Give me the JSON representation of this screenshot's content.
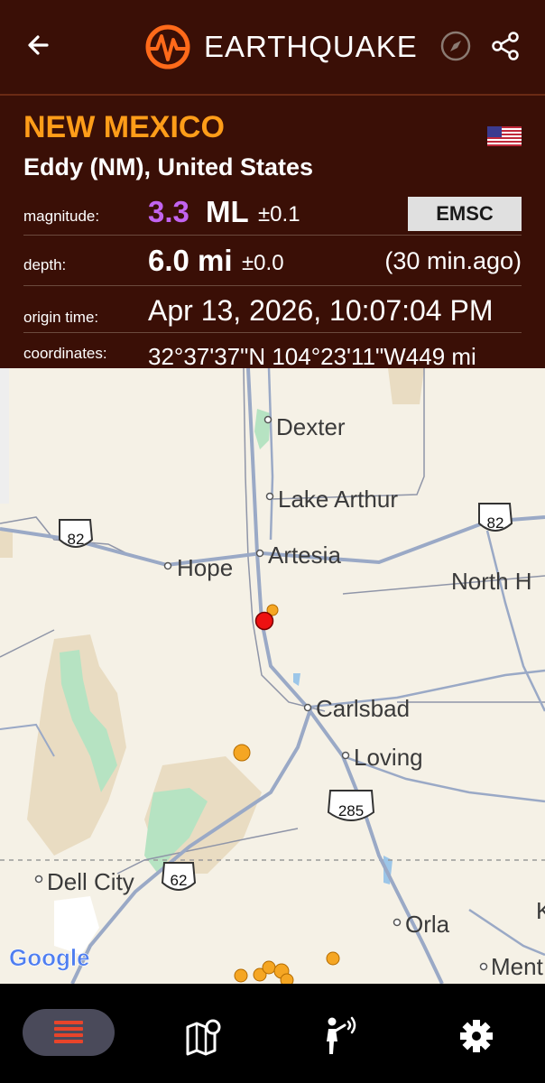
{
  "header": {
    "app_title": "EARTHQUAKE",
    "back_icon": "arrow-left-icon",
    "compass_icon": "compass-icon",
    "share_icon": "share-icon"
  },
  "event": {
    "region": "NEW MEXICO",
    "place": "Eddy (NM), United States",
    "flag_icon": "us-flag-icon",
    "magnitude_label": "magnitude:",
    "magnitude_value": "3.3",
    "magnitude_type": "ML",
    "magnitude_uncertainty": "±0.1",
    "source_badge": "EMSC",
    "depth_label": "depth:",
    "depth_value": "6.0 mi",
    "depth_uncertainty": "±0.0",
    "time_ago": "(30 min.ago)",
    "origin_label": "origin time:",
    "origin_time": "Apr 13, 2026, 10:07:04 PM",
    "coords_label": "coordinates:",
    "coords_value": "32°37'37\"N  104°23'11\"W449 mi"
  },
  "map": {
    "labels": [
      "Dexter",
      "Lake Arthur",
      "Artesia",
      "Hope",
      "North H",
      "Carlsbad",
      "Loving",
      "Dell City",
      "Orla",
      "Ment",
      "K"
    ],
    "shields": [
      "82",
      "82",
      "285",
      "62"
    ],
    "watermark": "Google"
  },
  "colors": {
    "header_bg": "#3a0f06",
    "accent_orange": "#ff9d19",
    "magnitude_purple": "#c264f0",
    "quake_red": "#ee1111",
    "quake_orange": "#f5a623"
  },
  "bottom_nav": {
    "items": [
      "list-icon",
      "map-pin-icon",
      "felt-report-icon",
      "settings-icon"
    ]
  }
}
